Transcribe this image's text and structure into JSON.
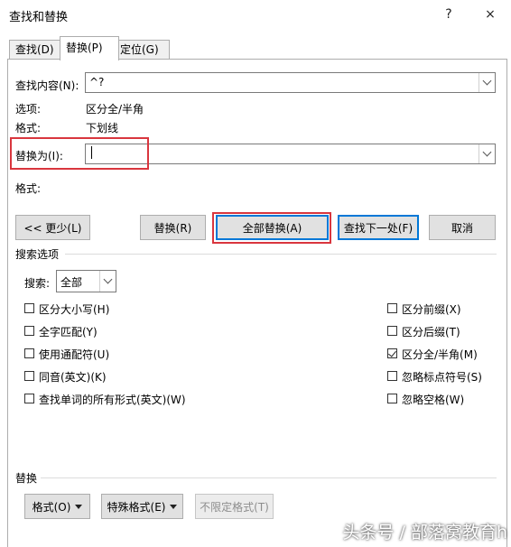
{
  "window": {
    "title": "查找和替换",
    "help": "?",
    "close": "×"
  },
  "tabs": [
    {
      "label": "查找(D)",
      "active": false
    },
    {
      "label": "替换(P)",
      "active": true
    },
    {
      "label": "定位(G)",
      "active": false
    }
  ],
  "find": {
    "label": "查找内容(N):",
    "value": "^?"
  },
  "options": {
    "label": "选项:",
    "value": "区分全/半角"
  },
  "find_format": {
    "label": "格式:",
    "value": "下划线"
  },
  "replace": {
    "label": "替换为(I):",
    "value": ""
  },
  "replace_format": {
    "label": "格式:"
  },
  "buttons": {
    "less": "<< 更少(L)",
    "replace": "替换(R)",
    "replace_all": "全部替换(A)",
    "find_next": "查找下一处(F)",
    "cancel": "取消"
  },
  "search_options": {
    "title": "搜索选项",
    "search_label": "搜索:",
    "search_value": "全部",
    "left_checkboxes": [
      {
        "label": "区分大小写(H)",
        "checked": false
      },
      {
        "label": "全字匹配(Y)",
        "checked": false
      },
      {
        "label": "使用通配符(U)",
        "checked": false
      },
      {
        "label": "同音(英文)(K)",
        "checked": false
      },
      {
        "label": "查找单词的所有形式(英文)(W)",
        "checked": false
      }
    ],
    "right_checkboxes": [
      {
        "label": "区分前缀(X)",
        "checked": false
      },
      {
        "label": "区分后缀(T)",
        "checked": false
      },
      {
        "label": "区分全/半角(M)",
        "checked": true
      },
      {
        "label": "忽略标点符号(S)",
        "checked": false
      },
      {
        "label": "忽略空格(W)",
        "checked": false
      }
    ]
  },
  "replace_section": {
    "title": "替换",
    "format_button": "格式(O)",
    "special_button": "特殊格式(E)",
    "no_format_button": "不限定格式(T)"
  },
  "watermark": "头条号 / 部落窝教育h",
  "colors": {
    "accent": "#0078d7",
    "highlight": "#d9363e"
  }
}
